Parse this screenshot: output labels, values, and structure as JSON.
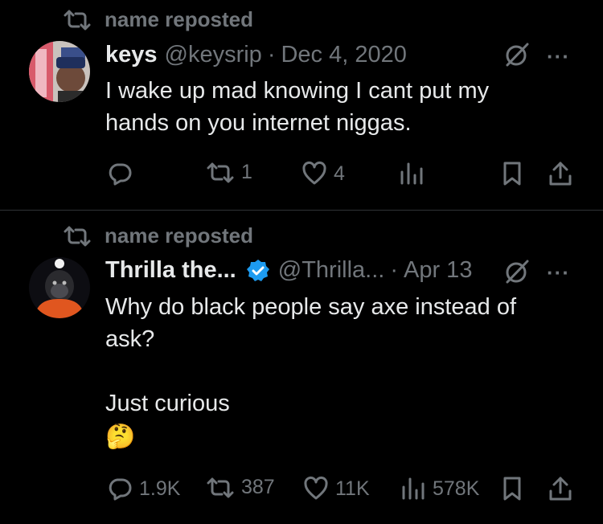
{
  "posts": [
    {
      "repost_label": "name reposted",
      "author_name": "keys",
      "handle": "@keysrip",
      "separator": "·",
      "date": "Dec 4, 2020",
      "more": "···",
      "text": "I wake up mad knowing I cant put my\nhands on you internet niggas.",
      "actions": {
        "replies": "",
        "reposts": "1",
        "likes": "4",
        "views": ""
      }
    },
    {
      "repost_label": "name reposted",
      "author_name": "Thrilla the...",
      "handle": "@Thrilla...",
      "separator": "·",
      "date": "Apr 13",
      "more": "···",
      "text": "Why do black people say axe instead of\nask?\n\nJust curious",
      "emoji": "🤔",
      "actions": {
        "replies": "1.9K",
        "reposts": "387",
        "likes": "11K",
        "views": "578K"
      }
    }
  ],
  "colors": {
    "background": "#000000",
    "text": "#e7e9ea",
    "muted": "#71767b",
    "verified": "#1d9bf0"
  },
  "icons": [
    "repost-icon",
    "reply-icon",
    "like-icon",
    "views-icon",
    "bookmark-icon",
    "share-icon",
    "grok-icon",
    "verified-icon"
  ]
}
